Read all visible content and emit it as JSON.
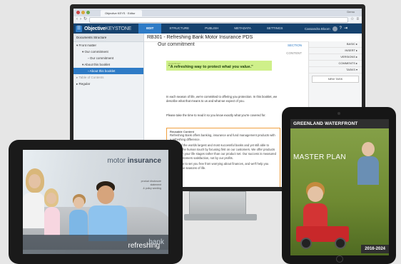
{
  "browser": {
    "tab_label": "Objective KEYS · Editor",
    "window_title": "Demo",
    "url": "",
    "nav_icons": [
      "back-icon",
      "forward-icon",
      "reload-icon"
    ]
  },
  "app": {
    "brand_bold": "Objective",
    "brand_light": "KEYSTONE",
    "menus": [
      "EDIT",
      "STRUCTURE",
      "PUBLISH",
      "METADATA",
      "SETTINGS"
    ],
    "active_menu": "EDIT",
    "user_name": "Cassandra Bloom",
    "accent": "#2e7bc6",
    "header_bg": "#16426e"
  },
  "sidebar": {
    "header": "Documents Structure",
    "items": [
      {
        "label": "Front matter",
        "level": 0,
        "arrow": "▾"
      },
      {
        "label": "Our commitment",
        "level": 1,
        "arrow": "▾"
      },
      {
        "label": "Our commitment",
        "level": 2,
        "arrow": ""
      },
      {
        "label": "About this booklet",
        "level": 1,
        "arrow": "▾"
      },
      {
        "label": "About this booklet",
        "level": 2,
        "arrow": "",
        "selected": true
      },
      {
        "label": "Table of Contents",
        "level": 0,
        "arrow": "▸"
      },
      {
        "label": "Regular",
        "level": 0,
        "arrow": "▸"
      }
    ]
  },
  "document": {
    "title": "RB301 - Refreshing Bank Motor Insurance PDS",
    "section_title": "Our commitment",
    "section_label": "SECTION",
    "content_label": "CONTENT",
    "quote_small": "Commitment",
    "quote": "\"A refreshing way to protect what you value.\"",
    "para1": "In each season of life, we're committed to offering you protection. In this booklet, we describe what that means to us and what we expect of you.",
    "para2": "Please take the time to read it so you know exactly what you're covered for.",
    "reusable_header": "Reusable Content",
    "reusable_text": "Refreshing Bank offers banking, insurance and fund management products with a refreshing difference.",
    "reusable_text2": "As one of the worlds largest and most successful banks and yet still able to maintain the human touch by focusing first on our customers. We offer products that match your life stages rather than our product set. Our success is measured by our customers satisfaction, not by our profits.",
    "reusable_text3": "We're here to set you free from worrying about finances, and we'll help you through the seasons of life."
  },
  "right_panel": {
    "items": [
      "BASIC ▸",
      "INSERT ▸",
      "VERSIONS ▸",
      "COMMENTS ▸",
      "TASKS ▾"
    ],
    "new_task": "NEW TASK"
  },
  "ipad_left": {
    "title_light": "motor",
    "title_bold": "insurance",
    "subtitle_lines": [
      "product disclosure",
      "statement",
      "& policy wording"
    ],
    "bank_a": "refreshing",
    "bank_b": "bank"
  },
  "tablet_right": {
    "banner": "GREENLAND WATERFRONT",
    "title": "MASTER PLAN",
    "years": "2016-2024"
  }
}
